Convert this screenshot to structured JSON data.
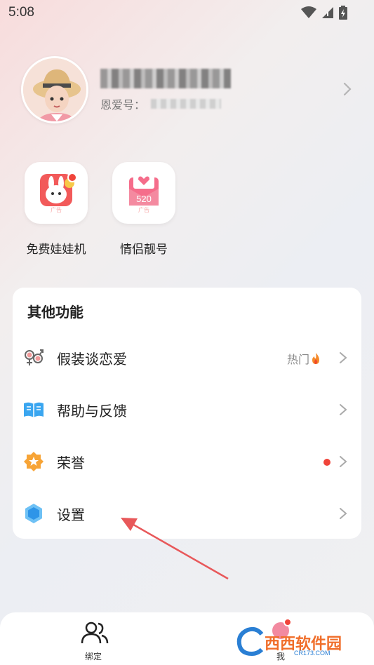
{
  "status_bar": {
    "time": "5:08"
  },
  "profile": {
    "id_label": "恩爱号：",
    "chevron_icon": "chevron-right-icon"
  },
  "promos": [
    {
      "label": "免费娃娃机",
      "badge": "广告",
      "icon": "claw-machine-rabbit-icon"
    },
    {
      "label": "情侣靓号",
      "badge": "广告",
      "number": "520",
      "icon": "love-letter-icon"
    }
  ],
  "other_functions": {
    "title": "其他功能",
    "items": [
      {
        "label": "假装谈恋爱",
        "tag": "热门",
        "icon": "gender-couple-icon"
      },
      {
        "label": "帮助与反馈",
        "icon": "book-icon"
      },
      {
        "label": "荣誉",
        "icon": "star-badge-icon",
        "has_dot": true
      },
      {
        "label": "设置",
        "icon": "hexagon-settings-icon"
      }
    ]
  },
  "tabbar": {
    "tabs": [
      {
        "label": "绑定",
        "icon": "people-icon"
      },
      {
        "label": "我",
        "icon": "me-icon"
      }
    ]
  },
  "watermark": {
    "text": "西西软件园",
    "sub": "CR173.COM"
  },
  "colors": {
    "accent_red": "#f0443a",
    "pink": "#f56d8b",
    "blue": "#3aa6f0",
    "orange": "#f7a436"
  }
}
